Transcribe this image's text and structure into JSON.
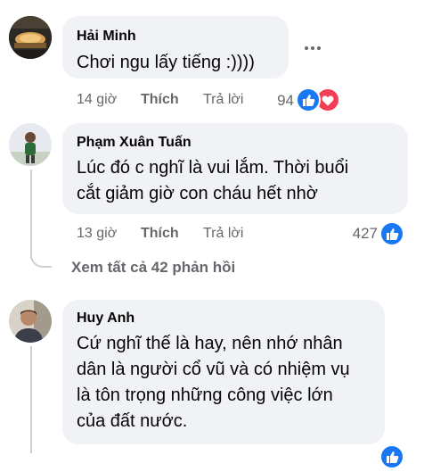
{
  "colors": {
    "like_blue": "#1877f2",
    "love_red": "#f33e58",
    "bubble_bg": "#f0f2f5",
    "meta_gray": "#65676b",
    "thread_line": "#ced0d4"
  },
  "comments": [
    {
      "author": "Hải Minh",
      "text": "Chơi ngu lấy tiếng :))))",
      "time": "14 giờ",
      "like_label": "Thích",
      "reply_label": "Trả lời",
      "reaction_count": "94",
      "reactions": [
        "like-icon",
        "love-icon"
      ],
      "more_label": "•••"
    },
    {
      "author": "Phạm Xuân Tuấn",
      "text_lines": [
        "Lúc đó c nghĩ là vui lắm. Thời buổi",
        "cắt giảm giờ con cháu hết nhờ"
      ],
      "time": "13 giờ",
      "like_label": "Thích",
      "reply_label": "Trả lời",
      "reaction_count": "427",
      "reactions": [
        "like-icon"
      ]
    },
    {
      "author": "Huy Anh",
      "text_lines": [
        "Cứ nghĩ thế là hay, nên nhớ nhân",
        "dân là người cổ vũ và có nhiệm vụ",
        "là tôn trọng những công việc lớn",
        "của đất nước."
      ],
      "reactions": [
        "like-icon"
      ]
    }
  ],
  "view_replies": "Xem tất cả 42 phản hồi"
}
